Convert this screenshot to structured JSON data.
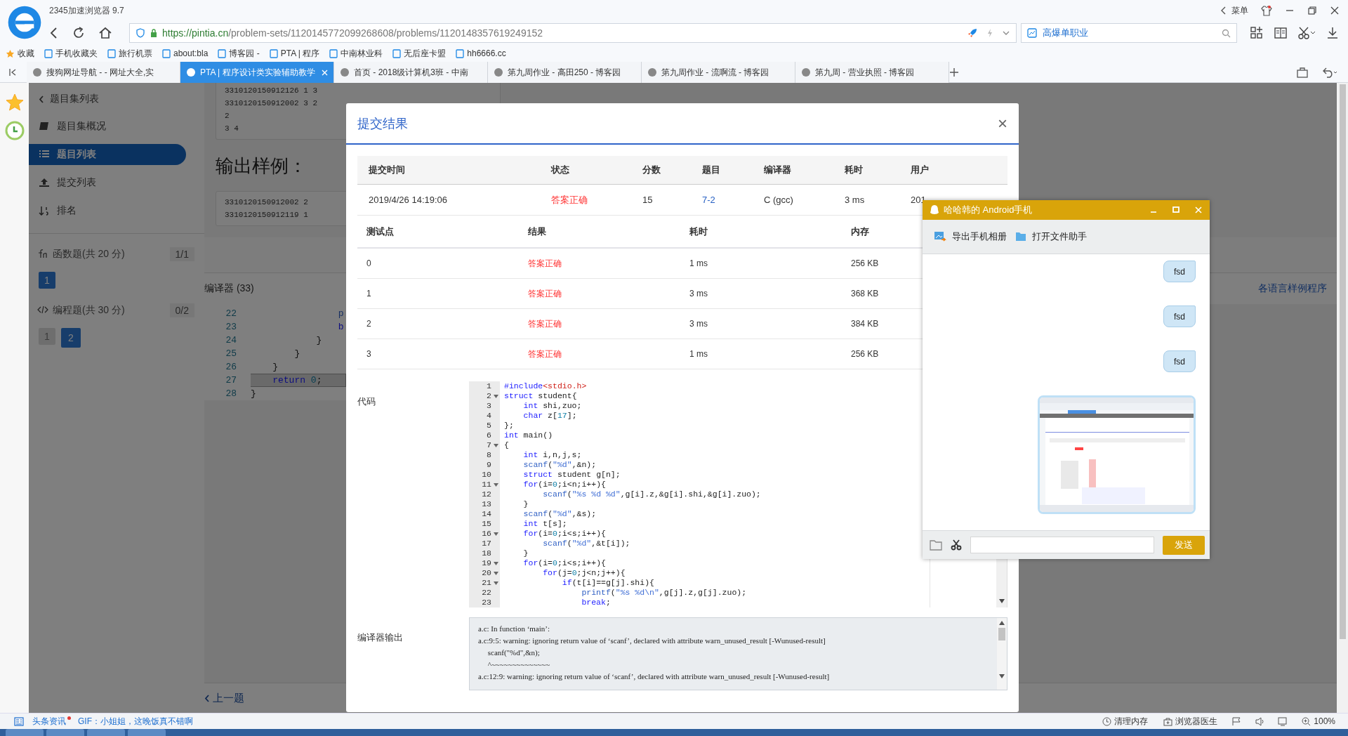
{
  "browser": {
    "title": "2345加速浏览器 9.7",
    "menu": "菜单",
    "url": {
      "host": "https://pintia.cn",
      "path": "/problem-sets/1120145772099268608/problems/1120148357619249152"
    },
    "search": "高爆单职业",
    "bookmarks": [
      "收藏",
      "手机收藏夹",
      "旅行机票",
      "about:bla",
      "博客园 -",
      "PTA | 程序",
      "中南林业科",
      "无后座卡盟",
      "hh6666.cc"
    ],
    "tabs": [
      {
        "label": "搜狗网址导航 - - 网址大全,实",
        "selected": false
      },
      {
        "label": "PTA | 程序设计类实验辅助教学",
        "selected": true
      },
      {
        "label": "首页 - 2018级计算机3班 - 中南",
        "selected": false
      },
      {
        "label": "第九周作业 - 高田250 - 博客园",
        "selected": false
      },
      {
        "label": "第九周作业 - 流啊流 - 博客园",
        "selected": false
      },
      {
        "label": "第九周 - 营业执照 - 博客园",
        "selected": false
      }
    ]
  },
  "sidebar": {
    "back": "题目集列表",
    "items": [
      {
        "label": "题目集概况",
        "selected": false
      },
      {
        "label": "题目列表",
        "selected": true
      },
      {
        "label": "提交列表",
        "selected": false
      },
      {
        "label": "排名",
        "selected": false
      }
    ],
    "sections": [
      {
        "kind": "function",
        "label": "函数题(共 20 分)",
        "count": "1/1",
        "problems": [
          {
            "label": "1",
            "selected": true
          }
        ]
      },
      {
        "kind": "code",
        "label": "编程题(共 30 分)",
        "count": "0/2",
        "problems": [
          {
            "label": "1",
            "selected": false
          },
          {
            "label": "2",
            "selected": true
          }
        ]
      }
    ]
  },
  "page": {
    "sample_input": [
      "3310120150912126 1 3",
      "3310120150912002 3 2",
      "2",
      "3 4"
    ],
    "output_heading": "输出样例：",
    "sample_output": [
      "3310120150912002 2",
      "3310120150912119 1"
    ],
    "compiler": "编译器 (33)",
    "samples_link": "各语言样例程序",
    "code_lines": [
      {
        "number": "22",
        "active": false,
        "segments": [
          {
            "text": "                p",
            "kind": "function"
          }
        ]
      },
      {
        "number": "23",
        "active": false,
        "segments": [
          {
            "text": "                b",
            "kind": "keyword"
          }
        ]
      },
      {
        "number": "24",
        "active": false,
        "segments": [
          {
            "text": "            }",
            "kind": "plain"
          }
        ]
      },
      {
        "number": "25",
        "active": false,
        "segments": [
          {
            "text": "        }",
            "kind": "plain"
          }
        ]
      },
      {
        "number": "26",
        "active": false,
        "segments": [
          {
            "text": "    }",
            "kind": "plain"
          }
        ]
      },
      {
        "number": "27",
        "active": true,
        "segments": [
          {
            "text": "    return",
            "kind": "keyword"
          },
          {
            "text": " 0",
            "kind": "number"
          },
          {
            "text": ";",
            "kind": "plain"
          }
        ]
      },
      {
        "number": "28",
        "active": false,
        "segments": [
          {
            "text": "}",
            "kind": "plain"
          }
        ]
      }
    ],
    "previous": "上一题"
  },
  "modal": {
    "title": "提交结果",
    "close": "×",
    "summary": {
      "columns": [
        "提交时间",
        "状态",
        "分数",
        "题目",
        "编译器",
        "耗时",
        "用户"
      ],
      "row": [
        {
          "text": "2019/4/26 14:19:06",
          "kind": "plain"
        },
        {
          "text": "答案正确",
          "kind": "status"
        },
        {
          "text": "15",
          "kind": "plain"
        },
        {
          "text": "7-2",
          "kind": "link"
        },
        {
          "text": "C (gcc)",
          "kind": "plain"
        },
        {
          "text": "3 ms",
          "kind": "plain"
        },
        {
          "text": "201",
          "kind": "plain"
        }
      ]
    },
    "tests": {
      "columns": [
        "测试点",
        "结果",
        "耗时",
        "内存"
      ],
      "rows": [
        [
          "0",
          "答案正确",
          "1 ms",
          "256 KB"
        ],
        [
          "1",
          "答案正确",
          "3 ms",
          "368 KB"
        ],
        [
          "2",
          "答案正确",
          "3 ms",
          "384 KB"
        ],
        [
          "3",
          "答案正确",
          "1 ms",
          "256 KB"
        ]
      ]
    },
    "code_label": "代码",
    "code": [
      {
        "number": "1",
        "foldable": false,
        "segments": [
          {
            "text": "#include",
            "kind": "keyword"
          },
          {
            "text": "<stdio.h>",
            "kind": "header"
          }
        ]
      },
      {
        "number": "2",
        "foldable": true,
        "segments": [
          {
            "text": "struct",
            "kind": "keyword"
          },
          {
            "text": " student{",
            "kind": "plain"
          }
        ]
      },
      {
        "number": "3",
        "foldable": false,
        "segments": [
          {
            "text": "    int",
            "kind": "keyword"
          },
          {
            "text": " shi,zuo;",
            "kind": "plain"
          }
        ]
      },
      {
        "number": "4",
        "foldable": false,
        "segments": [
          {
            "text": "    char",
            "kind": "keyword"
          },
          {
            "text": " z[",
            "kind": "plain"
          },
          {
            "text": "17",
            "kind": "number"
          },
          {
            "text": "];",
            "kind": "plain"
          }
        ]
      },
      {
        "number": "5",
        "foldable": false,
        "segments": [
          {
            "text": "};",
            "kind": "plain"
          }
        ]
      },
      {
        "number": "6",
        "foldable": false,
        "segments": [
          {
            "text": "int",
            "kind": "keyword"
          },
          {
            "text": " main()",
            "kind": "plain"
          }
        ]
      },
      {
        "number": "7",
        "foldable": true,
        "segments": [
          {
            "text": "{",
            "kind": "plain"
          }
        ]
      },
      {
        "number": "8",
        "foldable": false,
        "segments": [
          {
            "text": "    int",
            "kind": "keyword"
          },
          {
            "text": " i,n,j,s;",
            "kind": "plain"
          }
        ]
      },
      {
        "number": "9",
        "foldable": false,
        "segments": [
          {
            "text": "    scanf",
            "kind": "function"
          },
          {
            "text": "(",
            "kind": "plain"
          },
          {
            "text": "\"%d\"",
            "kind": "string"
          },
          {
            "text": ",&n);",
            "kind": "plain"
          }
        ]
      },
      {
        "number": "10",
        "foldable": false,
        "segments": [
          {
            "text": "    struct",
            "kind": "keyword"
          },
          {
            "text": " student g[n];",
            "kind": "plain"
          }
        ]
      },
      {
        "number": "11",
        "foldable": true,
        "segments": [
          {
            "text": "    for",
            "kind": "keyword"
          },
          {
            "text": "(i=",
            "kind": "plain"
          },
          {
            "text": "0",
            "kind": "number"
          },
          {
            "text": ";i<n;i++){",
            "kind": "plain"
          }
        ]
      },
      {
        "number": "12",
        "foldable": false,
        "segments": [
          {
            "text": "        scanf",
            "kind": "function"
          },
          {
            "text": "(",
            "kind": "plain"
          },
          {
            "text": "\"%s %d %d\"",
            "kind": "string"
          },
          {
            "text": ",g[i].z,&g[i].shi,&g[i].zuo);",
            "kind": "plain"
          }
        ]
      },
      {
        "number": "13",
        "foldable": false,
        "segments": [
          {
            "text": "    }",
            "kind": "plain"
          }
        ]
      },
      {
        "number": "14",
        "foldable": false,
        "segments": [
          {
            "text": "    scanf",
            "kind": "function"
          },
          {
            "text": "(",
            "kind": "plain"
          },
          {
            "text": "\"%d\"",
            "kind": "string"
          },
          {
            "text": ",&s);",
            "kind": "plain"
          }
        ]
      },
      {
        "number": "15",
        "foldable": false,
        "segments": [
          {
            "text": "    int",
            "kind": "keyword"
          },
          {
            "text": " t[s];",
            "kind": "plain"
          }
        ]
      },
      {
        "number": "16",
        "foldable": true,
        "segments": [
          {
            "text": "    for",
            "kind": "keyword"
          },
          {
            "text": "(i=",
            "kind": "plain"
          },
          {
            "text": "0",
            "kind": "number"
          },
          {
            "text": ";i<s;i++){",
            "kind": "plain"
          }
        ]
      },
      {
        "number": "17",
        "foldable": false,
        "segments": [
          {
            "text": "        scanf",
            "kind": "function"
          },
          {
            "text": "(",
            "kind": "plain"
          },
          {
            "text": "\"%d\"",
            "kind": "string"
          },
          {
            "text": ",&t[i]);",
            "kind": "plain"
          }
        ]
      },
      {
        "number": "18",
        "foldable": false,
        "segments": [
          {
            "text": "    }",
            "kind": "plain"
          }
        ]
      },
      {
        "number": "19",
        "foldable": true,
        "segments": [
          {
            "text": "    for",
            "kind": "keyword"
          },
          {
            "text": "(i=",
            "kind": "plain"
          },
          {
            "text": "0",
            "kind": "number"
          },
          {
            "text": ";i<s;i++){",
            "kind": "plain"
          }
        ]
      },
      {
        "number": "20",
        "foldable": true,
        "segments": [
          {
            "text": "        for",
            "kind": "keyword"
          },
          {
            "text": "(j=",
            "kind": "plain"
          },
          {
            "text": "0",
            "kind": "number"
          },
          {
            "text": ";j<n;j++){",
            "kind": "plain"
          }
        ]
      },
      {
        "number": "21",
        "foldable": true,
        "segments": [
          {
            "text": "            if",
            "kind": "keyword"
          },
          {
            "text": "(t[i]==g[j].shi){",
            "kind": "plain"
          }
        ]
      },
      {
        "number": "22",
        "foldable": false,
        "segments": [
          {
            "text": "                printf",
            "kind": "function"
          },
          {
            "text": "(",
            "kind": "plain"
          },
          {
            "text": "\"%s %d\\n\"",
            "kind": "string"
          },
          {
            "text": ",g[j].z,g[j].zuo);",
            "kind": "plain"
          }
        ]
      },
      {
        "number": "23",
        "foldable": false,
        "segments": [
          {
            "text": "                break",
            "kind": "keyword"
          },
          {
            "text": ";",
            "kind": "plain"
          }
        ]
      }
    ],
    "output_label": "编译器输出",
    "output": [
      "a.c: In function ‘main’:",
      "a.c:9:5: warning: ignoring return value of ‘scanf’, declared with attribute warn_unused_result [-Wunused-result]",
      "     scanf(\"%d\",&n);",
      "     ^~~~~~~~~~~~~~~",
      "a.c:12:9: warning: ignoring return value of ‘scanf’, declared with attribute warn_unused_result [-Wunused-result]"
    ]
  },
  "chat_window": {
    "title": "哈哈韩的 Android手机",
    "actions": [
      "导出手机相册",
      "打开文件助手"
    ],
    "messages": [
      {
        "kind": "text",
        "text": "fsd"
      },
      {
        "kind": "text",
        "text": "fsd"
      },
      {
        "kind": "text",
        "text": "fsd"
      },
      {
        "kind": "picture"
      }
    ],
    "send": "发送"
  },
  "status_bar": {
    "news": "头条资讯",
    "news_unread": true,
    "headline": "GIF：小姐姐，这晚饭真不错啊",
    "tools": [
      "清理内存",
      "浏览器医生"
    ],
    "zoom": "100%"
  }
}
